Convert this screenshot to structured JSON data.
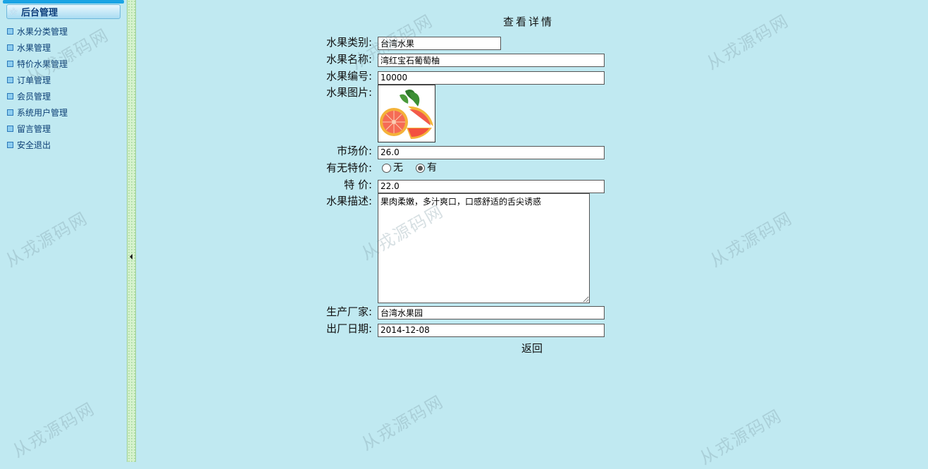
{
  "sidebar": {
    "header": "后台管理",
    "items": [
      {
        "label": "水果分类管理"
      },
      {
        "label": "水果管理"
      },
      {
        "label": "特价水果管理"
      },
      {
        "label": "订单管理"
      },
      {
        "label": "会员管理"
      },
      {
        "label": "系统用户管理"
      },
      {
        "label": "留言管理"
      },
      {
        "label": "安全退出"
      }
    ]
  },
  "detail": {
    "title": "查看详情",
    "category": {
      "label": "水果类别:",
      "value": "台湾水果"
    },
    "name": {
      "label": "水果名称:",
      "value": "湾红宝石葡萄柚"
    },
    "number": {
      "label": "水果编号:",
      "value": "10000"
    },
    "picture": {
      "label": "水果图片:"
    },
    "market_price": {
      "label": "市场价:",
      "value": "26.0"
    },
    "has_special": {
      "label": "有无特价:",
      "option_no": "无",
      "option_yes": "有",
      "selected": "有"
    },
    "special_price": {
      "label": "特 价:",
      "value": "22.0"
    },
    "description": {
      "label": "水果描述:",
      "value": "果肉柔嫩，多汁爽口，口感舒适的舌尖诱惑"
    },
    "manufacturer": {
      "label": "生产厂家:",
      "value": "台湾水果园"
    },
    "date": {
      "label": "出厂日期:",
      "value": "2014-12-08"
    },
    "back_label": "返回"
  },
  "watermark": "从戎源码网",
  "colors": {
    "background": "#c0e9f1",
    "accent": "#1aa4e4"
  }
}
